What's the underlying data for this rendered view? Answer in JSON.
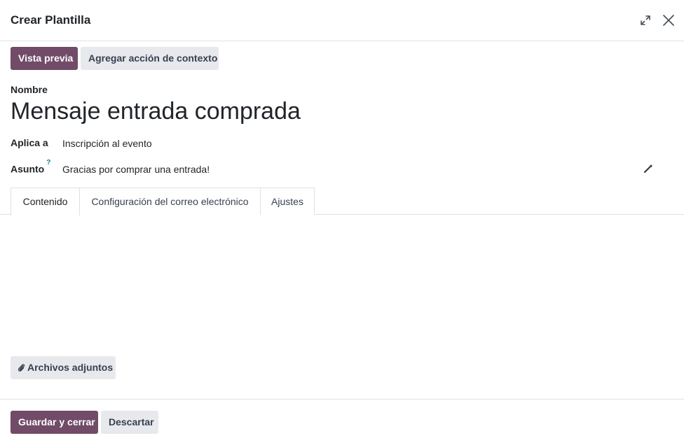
{
  "dialog": {
    "title": "Crear Plantilla"
  },
  "toolbar": {
    "preview_label": "Vista previa",
    "context_action_label": "Agregar acción de contexto"
  },
  "form": {
    "name_label": "Nombre",
    "name_value": "Mensaje entrada comprada",
    "applies_label": "Aplica a",
    "applies_value": "Inscripción al evento",
    "subject_label": "Asunto",
    "subject_help": "?",
    "subject_value": "Gracias por comprar una entrada!"
  },
  "tabs": [
    {
      "label": "Contenido",
      "active": true
    },
    {
      "label": "Configuración del correo electrónico",
      "active": false
    },
    {
      "label": "Ajustes",
      "active": false
    }
  ],
  "attachments": {
    "label": "Archivos adjuntos"
  },
  "footer": {
    "save_label": "Guardar y cerrar",
    "discard_label": "Descartar"
  },
  "colors": {
    "primary": "#714b67",
    "secondary_bg": "#e7e9ed",
    "border": "#dee2e6",
    "help": "#017e84"
  },
  "icons": {
    "expand": "expand-icon",
    "close": "close-icon",
    "wand": "magic-wand-icon",
    "attach": "paperclip-icon"
  }
}
